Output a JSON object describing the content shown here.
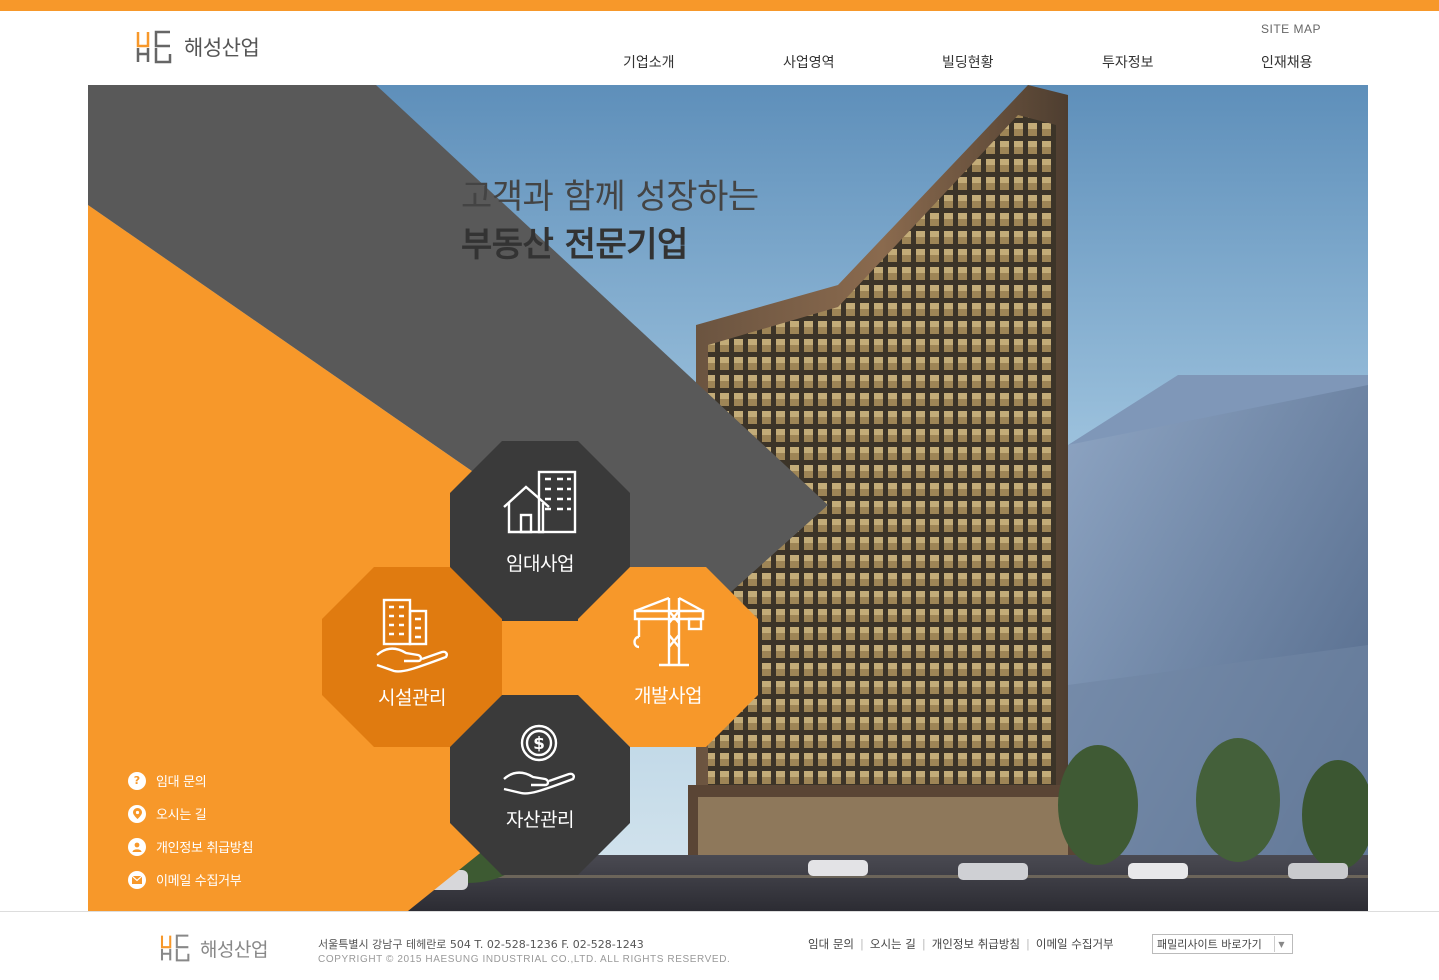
{
  "header": {
    "logo_text": "해성산업",
    "site_map": "SITE MAP",
    "nav": [
      "기업소개",
      "사업영역",
      "빌딩현황",
      "투자정보",
      "인재채용"
    ]
  },
  "hero": {
    "slogan_line1": "고객과 함께 성장하는",
    "slogan_line2": "부동산 전문기업"
  },
  "tiles": {
    "lease": "임대사업",
    "facility": "시설관리",
    "development": "개발사업",
    "asset": "자산관리"
  },
  "quick_links": [
    {
      "label": "임대 문의",
      "icon": "question-icon"
    },
    {
      "label": "오시는 길",
      "icon": "location-pin-icon"
    },
    {
      "label": "개인정보 취급방침",
      "icon": "person-icon"
    },
    {
      "label": "이메일 수집거부",
      "icon": "mail-icon"
    }
  ],
  "footer": {
    "logo_text": "해성산업",
    "address": "서울특별시 강남구 테헤란로 504 T. 02-528-1236 F. 02-528-1243",
    "copyright": "COPYRIGHT © 2015 HAESUNG INDUSTRIAL CO.,LTD. ALL RIGHTS RESERVED.",
    "links": [
      "임대 문의",
      "오시는 길",
      "개인정보 취급방침",
      "이메일 수집거부"
    ],
    "family_site": "패밀리사이트 바로가기"
  },
  "colors": {
    "orange": "#f7982a",
    "dark_orange": "#e07b10",
    "dark_gray": "#3a3a3a",
    "band_gray": "#5a5a5a"
  }
}
